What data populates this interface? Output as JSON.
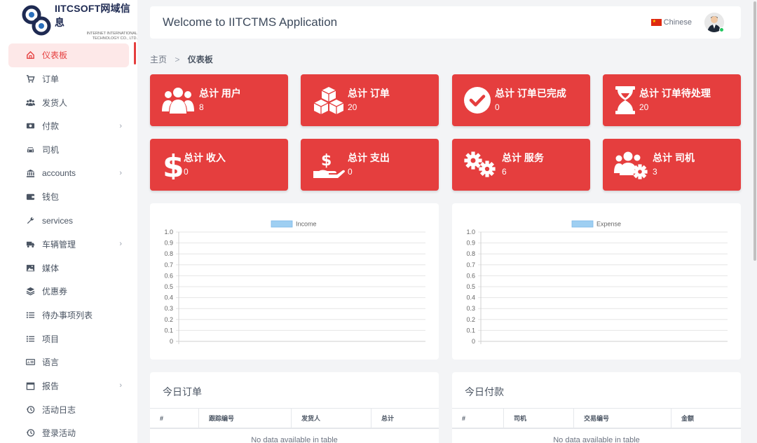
{
  "logo": {
    "title": "IITCSOFT网域信息",
    "subtitle_line1": "INTERNET INTERNATIONAL",
    "subtitle_line2": "TECHNOLOGY CO., LTD."
  },
  "sidebar": {
    "items": [
      {
        "label": "仪表板",
        "icon": "home-icon"
      },
      {
        "label": "订单",
        "icon": "cart-icon"
      },
      {
        "label": "发货人",
        "icon": "users-icon"
      },
      {
        "label": "付款",
        "icon": "money-icon",
        "chevron": "›"
      },
      {
        "label": "司机",
        "icon": "car-icon"
      },
      {
        "label": "accounts",
        "icon": "bank-icon",
        "chevron": "›"
      },
      {
        "label": "钱包",
        "icon": "wallet-icon"
      },
      {
        "label": "services",
        "icon": "wrench-icon"
      },
      {
        "label": "车辆管理",
        "icon": "truck-icon",
        "chevron": "›"
      },
      {
        "label": "媒体",
        "icon": "image-icon"
      },
      {
        "label": "优惠券",
        "icon": "layers-icon"
      },
      {
        "label": "待办事项列表",
        "icon": "list-icon"
      },
      {
        "label": "项目",
        "icon": "list-icon"
      },
      {
        "label": "语言",
        "icon": "language-icon"
      },
      {
        "label": "报告",
        "icon": "calendar-icon",
        "chevron": "›"
      },
      {
        "label": "活动日志",
        "icon": "history-icon"
      },
      {
        "label": "登录活动",
        "icon": "history-icon"
      }
    ]
  },
  "header": {
    "title": "Welcome to IITCTMS Application",
    "language": "Chinese"
  },
  "breadcrumb": {
    "home": "主页",
    "separator": ">",
    "current": "仪表板"
  },
  "cards": [
    {
      "label": "总计 用户",
      "value": "8",
      "icon": "users-icon"
    },
    {
      "label": "总计 订单",
      "value": "20",
      "icon": "cubes-icon"
    },
    {
      "label": "总计 订单已完成",
      "value": "0",
      "icon": "check-circle-icon"
    },
    {
      "label": "总计 订单待处理",
      "value": "20",
      "icon": "hourglass-icon"
    },
    {
      "label": "总计 收入",
      "value": "0",
      "icon": "dollar-icon"
    },
    {
      "label": "总计 支出",
      "value": "0",
      "icon": "hand-dollar-icon"
    },
    {
      "label": "总计 服务",
      "value": "6",
      "icon": "cogs-icon"
    },
    {
      "label": "总计 司机",
      "value": "3",
      "icon": "users-cog-icon"
    }
  ],
  "chart_data": [
    {
      "type": "bar",
      "series": [
        {
          "name": "Income",
          "values": []
        }
      ],
      "categories": [],
      "ylim": [
        0,
        1.0
      ],
      "yticks": [
        "1.0",
        "0.9",
        "0.8",
        "0.7",
        "0.6",
        "0.5",
        "0.4",
        "0.3",
        "0.2",
        "0.1",
        "0"
      ],
      "grid": true,
      "legend": "top-center",
      "color": "#9ecff2"
    },
    {
      "type": "bar",
      "series": [
        {
          "name": "Expense",
          "values": []
        }
      ],
      "categories": [],
      "ylim": [
        0,
        1.0
      ],
      "yticks": [
        "1.0",
        "0.9",
        "0.8",
        "0.7",
        "0.6",
        "0.5",
        "0.4",
        "0.3",
        "0.2",
        "0.1",
        "0"
      ],
      "grid": true,
      "legend": "top-center",
      "color": "#9ecff2"
    }
  ],
  "orders_table": {
    "title": "今日订单",
    "columns": [
      "#",
      "跟踪编号",
      "发货人",
      "总计"
    ],
    "empty": "No data available in table"
  },
  "payments_table": {
    "title": "今日付款",
    "columns": [
      "#",
      "司机",
      "交易编号",
      "金额"
    ],
    "empty": "No data available in table"
  },
  "colors": {
    "accent": "#e53e3e",
    "chart_bar": "#9ecff2"
  }
}
